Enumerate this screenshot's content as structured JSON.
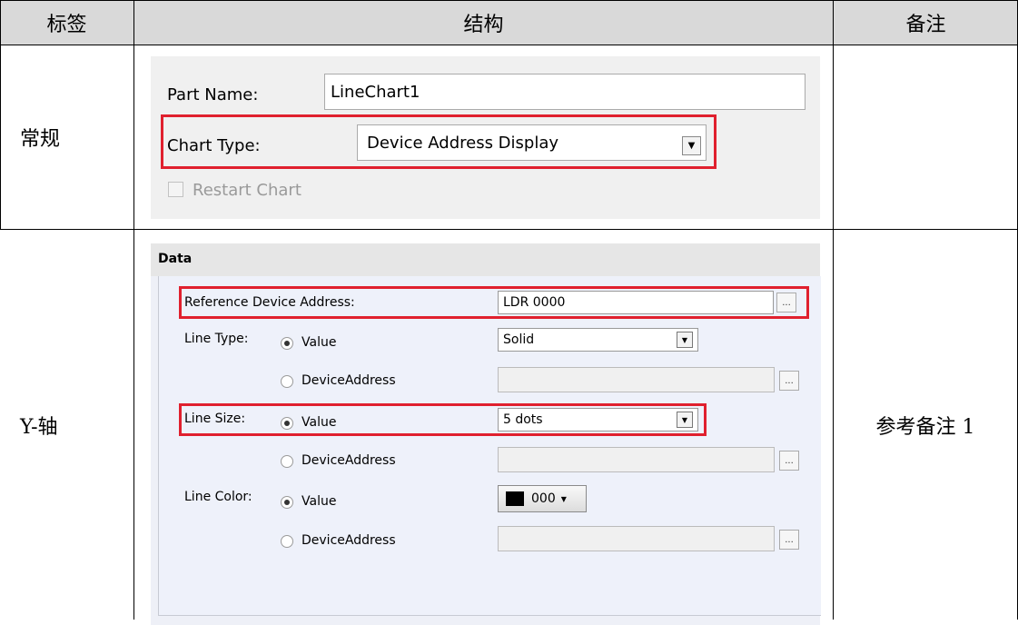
{
  "headers": [
    "标签",
    "结构",
    "备注"
  ],
  "rows": [
    {
      "label": "常规",
      "note": ""
    },
    {
      "label": "Y-轴",
      "note": "参考备注 1"
    }
  ],
  "general_panel": {
    "part_name_label": "Part Name:",
    "part_name_value": "LineChart1",
    "chart_type_label": "Chart Type:",
    "chart_type_value": "Device Address Display",
    "restart_chart_label": "Restart Chart"
  },
  "data_panel": {
    "title": "Data",
    "reference_label": "Reference Device Address:",
    "reference_value": "LDR 0000",
    "line_type_label": "Line Type:",
    "line_type_value_option": "Value",
    "line_type_device_option": "DeviceAddress",
    "line_type_value": "Solid",
    "line_size_label": "Line Size:",
    "line_size_value_option": "Value",
    "line_size_device_option": "DeviceAddress",
    "line_size_value": "5 dots",
    "line_color_label": "Line Color:",
    "line_color_value_option": "Value",
    "line_color_device_option": "DeviceAddress",
    "line_color_value": "000",
    "dots_label": "..."
  },
  "colors": {
    "header_bg": "#d9d9d9",
    "highlight": "#e0202e",
    "swatch": "#000000"
  }
}
